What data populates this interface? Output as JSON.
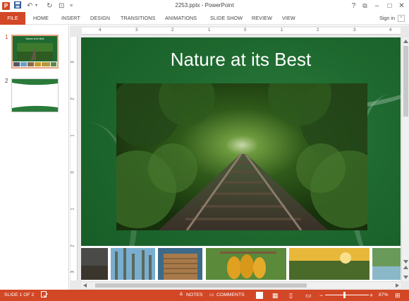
{
  "titlebar": {
    "app_logo": "P",
    "save_icon": "💾",
    "undo_icon": "↶",
    "redo_icon": "↻",
    "start_icon": "⊡",
    "customize_icon": "≡",
    "doc_title": "2253.pptx - PowerPoint",
    "help_icon": "?",
    "restore_icon": "⧉",
    "minimize_icon": "–",
    "maximize_icon": "□",
    "close_icon": "✕"
  },
  "ribbon": {
    "tabs": [
      "FILE",
      "HOME",
      "INSERT",
      "DESIGN",
      "TRANSITIONS",
      "ANIMATIONS",
      "SLIDE SHOW",
      "REVIEW",
      "VIEW"
    ],
    "signin": "Sign in",
    "collapse_icon": "^"
  },
  "thumbnails": {
    "items": [
      {
        "number": "1",
        "title": "Nature at its Best"
      },
      {
        "number": "2",
        "title": ""
      }
    ]
  },
  "ruler": {
    "h_ticks": [
      "4",
      "3",
      "2",
      "1",
      "0",
      "1",
      "2",
      "3",
      "4"
    ],
    "v_ticks": [
      "3",
      "2",
      "1",
      "0",
      "1",
      "2",
      "3"
    ]
  },
  "slide": {
    "title": "Nature at its Best"
  },
  "status": {
    "slide_info": "SLIDE 1 OF 2",
    "notes_label": "NOTES",
    "comments_label": "COMMENTS",
    "zoom_minus": "−",
    "zoom_plus": "+",
    "zoom": "87%",
    "accent": "#d24726"
  }
}
